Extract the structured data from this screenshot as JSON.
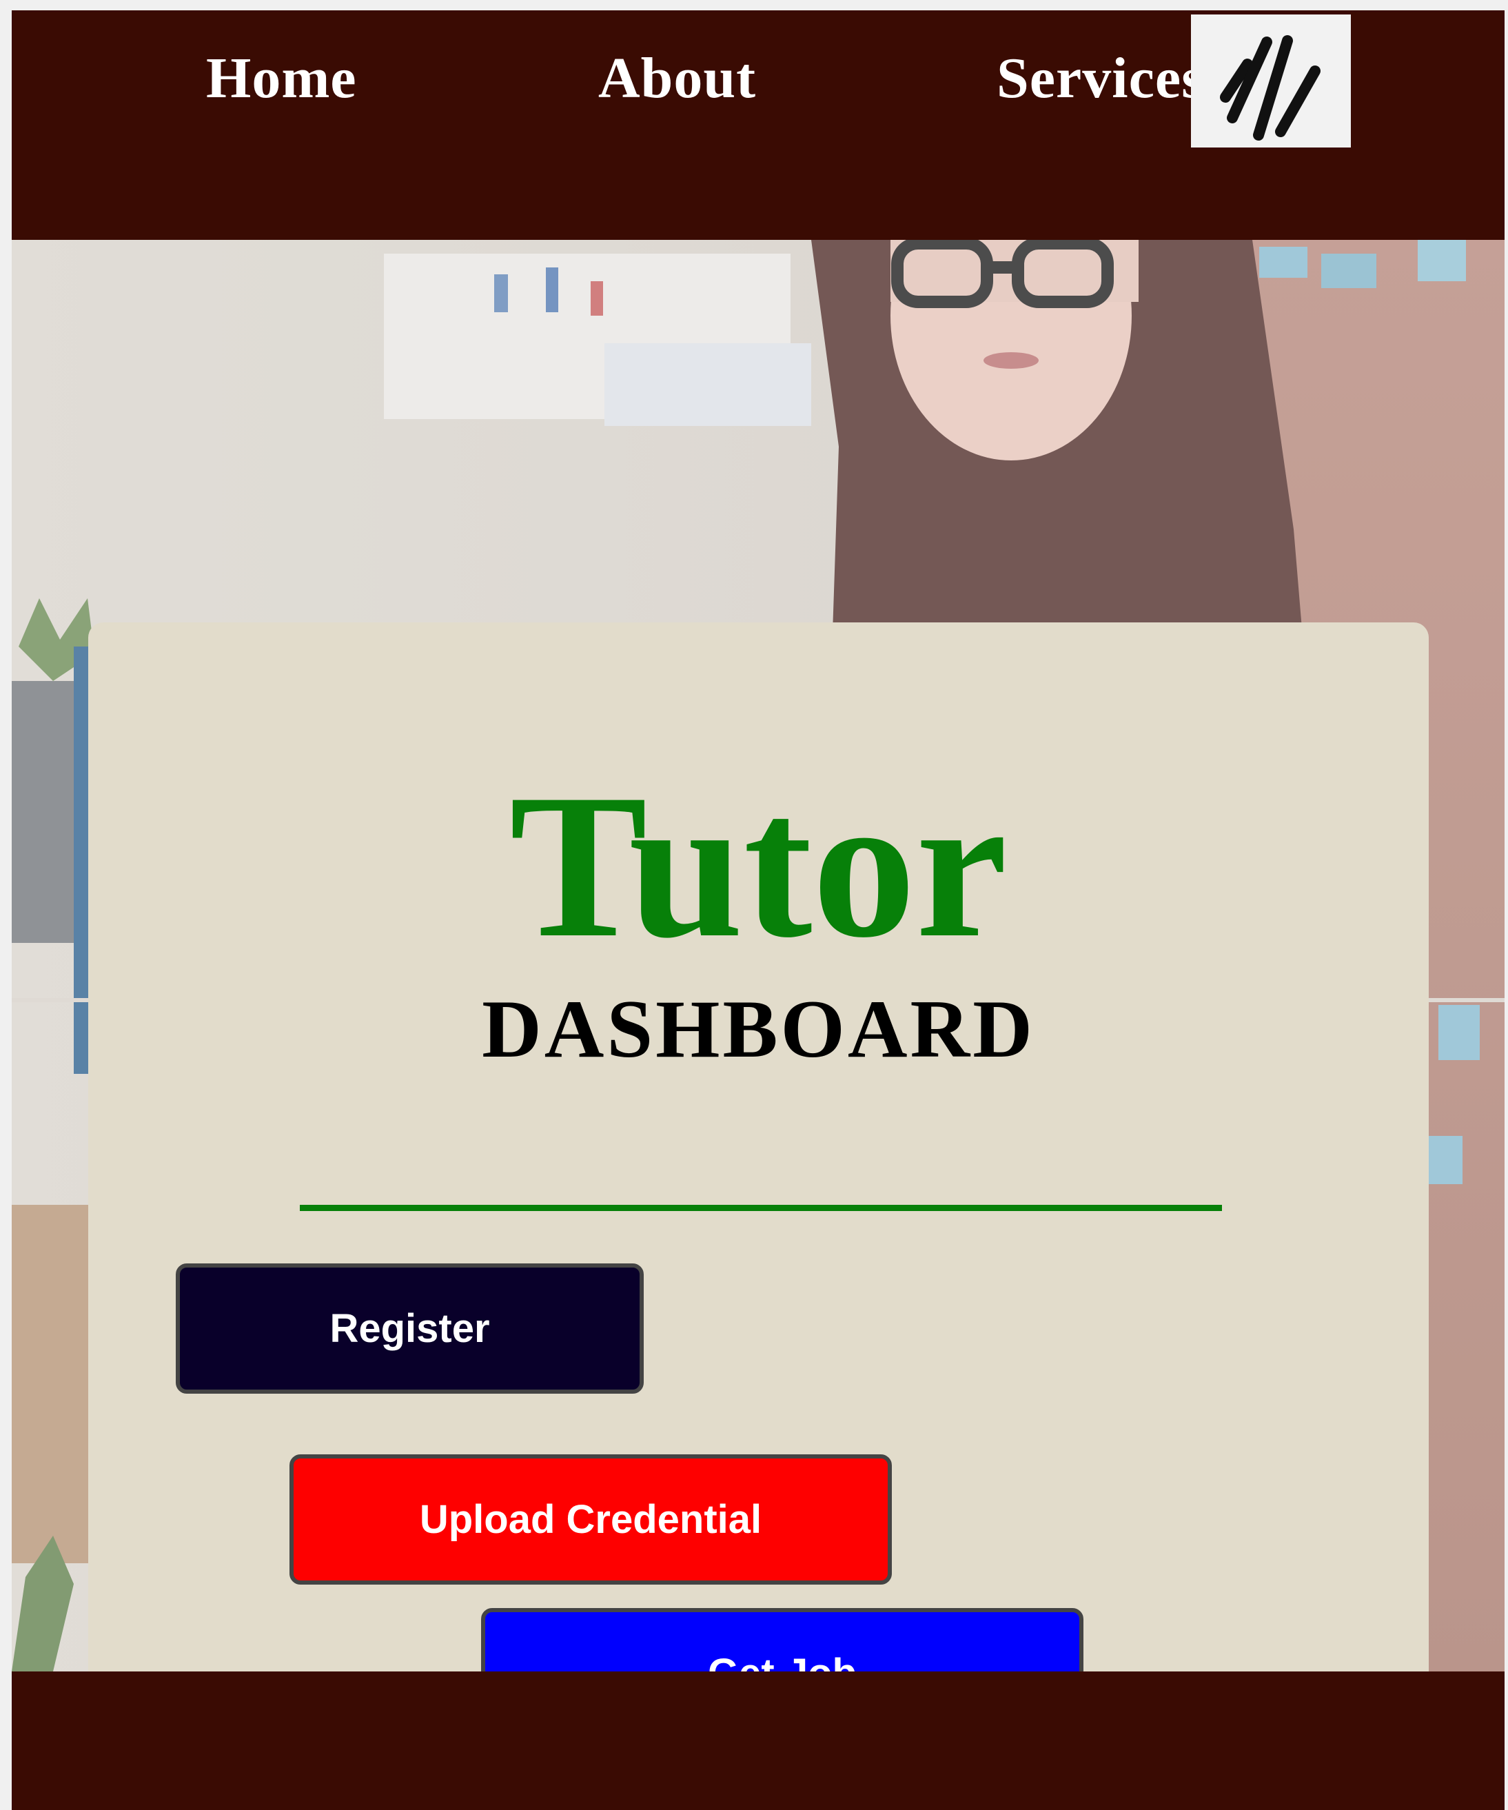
{
  "nav": {
    "items": [
      {
        "label": "Home"
      },
      {
        "label": "About"
      },
      {
        "label": "Services"
      }
    ],
    "menu_icon": "menu-icon"
  },
  "hero": {
    "background": "photo-of-woman-at-desk"
  },
  "card": {
    "title": "Tutor",
    "subtitle": "DASHBOARD",
    "buttons": {
      "register": "Register",
      "upload": "Upload Credential",
      "get_job": "Get Job"
    }
  },
  "colors": {
    "nav_bg": "#3a0b03",
    "card_bg": "#e2dccb",
    "title": "#078009",
    "register_bg": "#09002a",
    "upload_bg": "#fe0000",
    "get_job_bg": "#0000fe"
  }
}
